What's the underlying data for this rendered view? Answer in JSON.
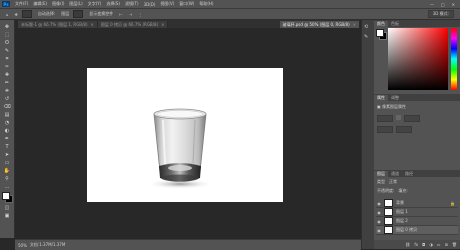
{
  "menubar": {
    "logo": "Ps",
    "items": [
      "文件(F)",
      "编辑(E)",
      "图像(I)",
      "图层(L)",
      "文字(Y)",
      "选择(S)",
      "滤镜(T)",
      "3D(D)",
      "视图(V)",
      "窗口(W)",
      "帮助(H)"
    ],
    "window_controls": [
      "—",
      "□",
      "✕"
    ]
  },
  "optionsbar": {
    "items": [
      "自动选择:",
      "图层",
      "显示变换控件"
    ],
    "mode_label": "3D 模式:"
  },
  "tabs": [
    {
      "label": "未标题-1 @ 66.7% (图层 1, RGB/8)",
      "close": "×",
      "active": false
    },
    {
      "label": "图层 0 拷贝 @ 66.7% (RGB/8)",
      "close": "×",
      "active": false
    },
    {
      "label": "玻璃杯.psd @ 50% (图层 0, RGB/8)",
      "close": "×",
      "active": true
    }
  ],
  "toolbar": {
    "tools": [
      "move-tool-icon",
      "marquee-tool-icon",
      "lasso-tool-icon",
      "quick-select-tool-icon",
      "crop-tool-icon",
      "eyedropper-tool-icon",
      "healing-tool-icon",
      "brush-tool-icon",
      "stamp-tool-icon",
      "history-brush-tool-icon",
      "eraser-tool-icon",
      "gradient-tool-icon",
      "blur-tool-icon",
      "dodge-tool-icon",
      "pen-tool-icon",
      "type-tool-icon",
      "path-select-tool-icon",
      "shape-tool-icon",
      "hand-tool-icon",
      "zoom-tool-icon",
      "edit-toolbar-icon"
    ],
    "glyphs": [
      "✥",
      "⬚",
      "ʘ",
      "✎",
      "⌗",
      "✑",
      "✚",
      "✏",
      "⎈",
      "↺",
      "⌫",
      "▤",
      "◔",
      "◐",
      "✒",
      "T",
      "➤",
      "▭",
      "✋",
      "⚲",
      "…"
    ]
  },
  "statusbar": {
    "zoom": "50%",
    "doc_info": "文档:1.37M/1.37M"
  },
  "color_panel": {
    "tabs": [
      "颜色",
      "色板"
    ],
    "hue_color": "#ff0000"
  },
  "properties_panel": {
    "tabs": [
      "属性",
      "调整"
    ],
    "title": "像素图层属性"
  },
  "layers_panel": {
    "tabs": [
      "图层",
      "通道",
      "路径"
    ],
    "kind": "类型",
    "mode": "正常",
    "opacity_label": "不透明度:",
    "fill_label": "填充:",
    "layers": [
      {
        "name": "背景",
        "selected": false
      },
      {
        "name": "图层 1",
        "selected": false
      },
      {
        "name": "图层 2",
        "selected": false
      },
      {
        "name": "图层 0 拷贝",
        "selected": true
      }
    ]
  },
  "colors": {
    "accent": "#31a8ff",
    "foreground": "#ffffff",
    "background": "#000000"
  }
}
